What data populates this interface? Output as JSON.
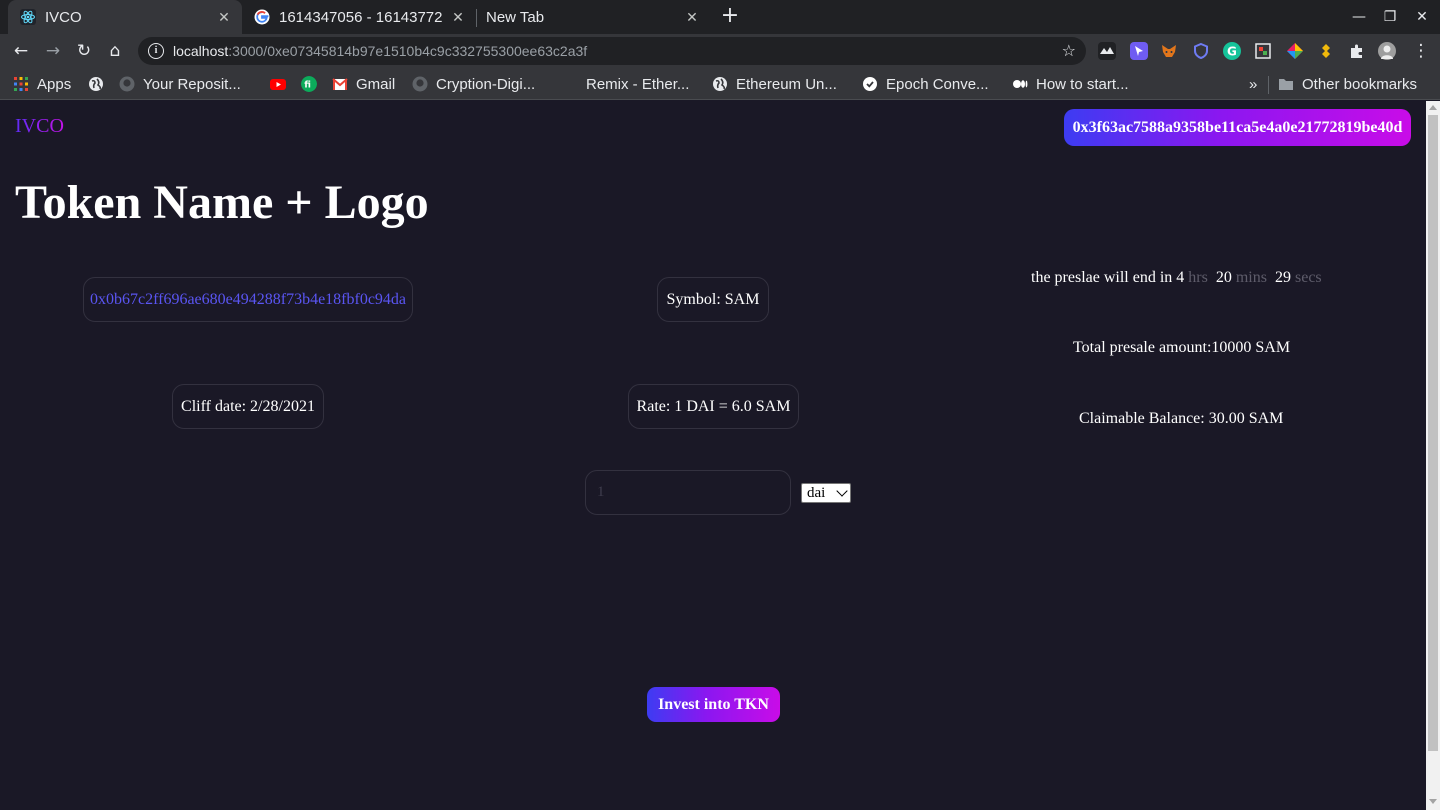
{
  "browser": {
    "tabs": [
      {
        "title": "IVCO",
        "active": true,
        "icon": "react-icon"
      },
      {
        "title": "1614347056 - 16143772",
        "active": false,
        "icon": "google-icon"
      },
      {
        "title": "New Tab",
        "active": false,
        "icon": ""
      }
    ],
    "url": {
      "host": "localhost",
      "path": ":3000/0xe07345814b97e1510b4c9c332755300ee63c2a3f"
    },
    "bookmarks": [
      {
        "label": "Apps",
        "icon": "apps-grid-icon"
      },
      {
        "label": "",
        "icon": "globe-icon"
      },
      {
        "label": "Your Reposit...",
        "icon": "github-icon"
      },
      {
        "label": "",
        "icon": "youtube-icon"
      },
      {
        "label": "",
        "icon": "fi-icon"
      },
      {
        "label": "Gmail",
        "icon": "gmail-icon"
      },
      {
        "label": "Cryption-Digi...",
        "icon": "github-icon"
      },
      {
        "label": "Remix - Ether...",
        "icon": ""
      },
      {
        "label": "Ethereum Un...",
        "icon": "globe-icon"
      },
      {
        "label": "Epoch Conve...",
        "icon": "epoch-icon"
      },
      {
        "label": "How to start...",
        "icon": "medium-icon"
      }
    ],
    "more_bookmarks": "»",
    "other_bookmarks": "Other bookmarks"
  },
  "app": {
    "brand": "IVCO",
    "wallet_address": "0x3f63ac7588a9358be11ca5e4a0e21772819be40d",
    "heading": "Token Name + Logo",
    "token_address": "0x0b67c2ff696ae680e494288f73b4e18fbf0c94da",
    "symbol": "Symbol: SAM",
    "cliff_date": "Cliff date: 2/28/2021",
    "rate": "Rate: 1 DAI = 6.0 SAM",
    "countdown": {
      "prefix": "the preslae will end in",
      "hours": "4",
      "hours_unit": "hrs",
      "minutes": "20",
      "minutes_unit": "mins",
      "seconds": "29",
      "seconds_unit": "secs"
    },
    "total_presale": "Total presale amount:10000 SAM",
    "claimable": "Claimable Balance: 30.00 SAM",
    "amount_placeholder": "1",
    "currency_selected": "dai",
    "invest_label": "Invest into TKN"
  },
  "colors": {
    "page_bg": "#1a1826",
    "accent_start": "#3d3cf2",
    "accent_end": "#c90ce8",
    "link": "#5a55f2"
  }
}
